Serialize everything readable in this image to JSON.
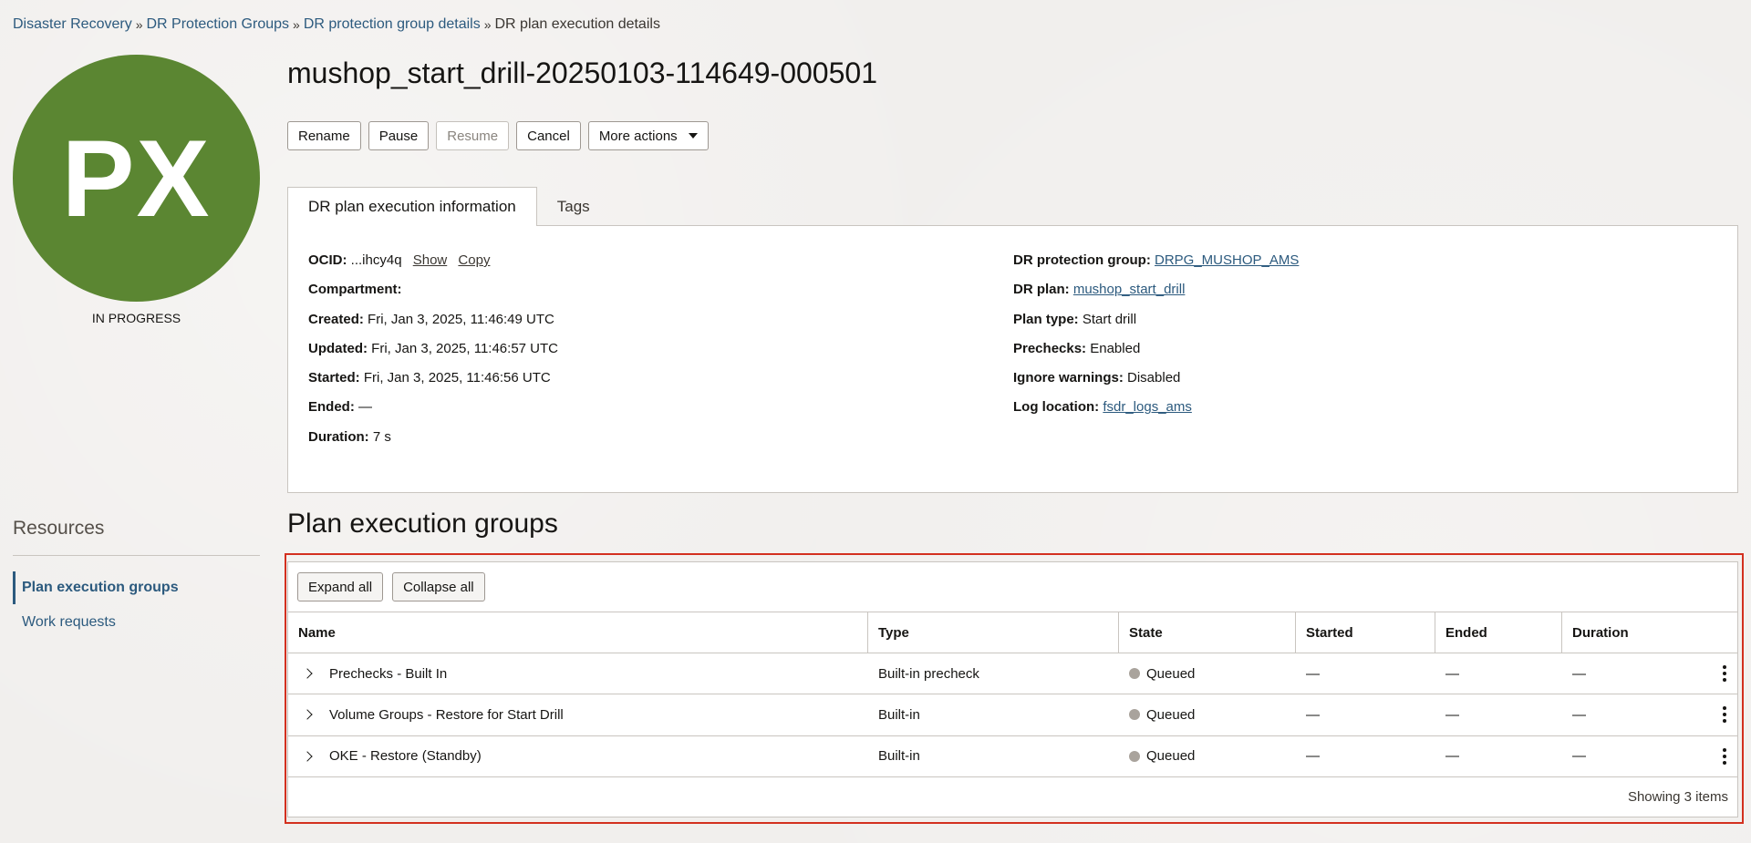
{
  "breadcrumb": {
    "items": [
      {
        "label": "Disaster Recovery"
      },
      {
        "label": "DR Protection Groups"
      },
      {
        "label": "DR protection group details"
      },
      {
        "label": "DR plan execution details"
      }
    ],
    "separator": "»"
  },
  "avatar": {
    "initials": "PX",
    "status": "IN PROGRESS",
    "color": "#5b8632"
  },
  "page": {
    "title": "mushop_start_drill-20250103-114649-000501"
  },
  "actions": {
    "rename": "Rename",
    "pause": "Pause",
    "resume": "Resume",
    "cancel": "Cancel",
    "more": "More actions"
  },
  "tabs": [
    {
      "label": "DR plan execution information",
      "active": true
    },
    {
      "label": "Tags",
      "active": false
    }
  ],
  "info": {
    "left": {
      "ocid_label": "OCID:",
      "ocid_value": "...ihcy4q",
      "show_label": "Show",
      "copy_label": "Copy",
      "compartment_label": "Compartment:",
      "created_label": "Created:",
      "created_value": "Fri, Jan 3, 2025, 11:46:49 UTC",
      "updated_label": "Updated:",
      "updated_value": "Fri, Jan 3, 2025, 11:46:57 UTC",
      "started_label": "Started:",
      "started_value": "Fri, Jan 3, 2025, 11:46:56 UTC",
      "ended_label": "Ended:",
      "ended_value": "—",
      "duration_label": "Duration:",
      "duration_value": "7 s"
    },
    "right": {
      "protection_group_label": "DR protection group:",
      "protection_group_value": "DRPG_MUSHOP_AMS",
      "plan_label": "DR plan:",
      "plan_value": "mushop_start_drill",
      "plan_type_label": "Plan type:",
      "plan_type_value": "Start drill",
      "prechecks_label": "Prechecks:",
      "prechecks_value": "Enabled",
      "ignore_label": "Ignore warnings:",
      "ignore_value": "Disabled",
      "log_label": "Log location:",
      "log_value": "fsdr_logs_ams"
    }
  },
  "resources": {
    "title": "Resources",
    "items": [
      {
        "label": "Plan execution groups",
        "active": true
      },
      {
        "label": "Work requests",
        "active": false
      }
    ]
  },
  "groups": {
    "title": "Plan execution groups",
    "expand_all": "Expand all",
    "collapse_all": "Collapse all",
    "columns": [
      "Name",
      "Type",
      "State",
      "Started",
      "Ended",
      "Duration"
    ],
    "rows": [
      {
        "name": "Prechecks - Built In",
        "type": "Built-in precheck",
        "state": "Queued",
        "started": "—",
        "ended": "—",
        "duration": "—"
      },
      {
        "name": "Volume Groups - Restore for Start Drill",
        "type": "Built-in",
        "state": "Queued",
        "started": "—",
        "ended": "—",
        "duration": "—"
      },
      {
        "name": "OKE - Restore (Standby)",
        "type": "Built-in",
        "state": "Queued",
        "started": "—",
        "ended": "—",
        "duration": "—"
      }
    ],
    "footer": "Showing 3 items",
    "highlight_color": "#d3301f"
  }
}
